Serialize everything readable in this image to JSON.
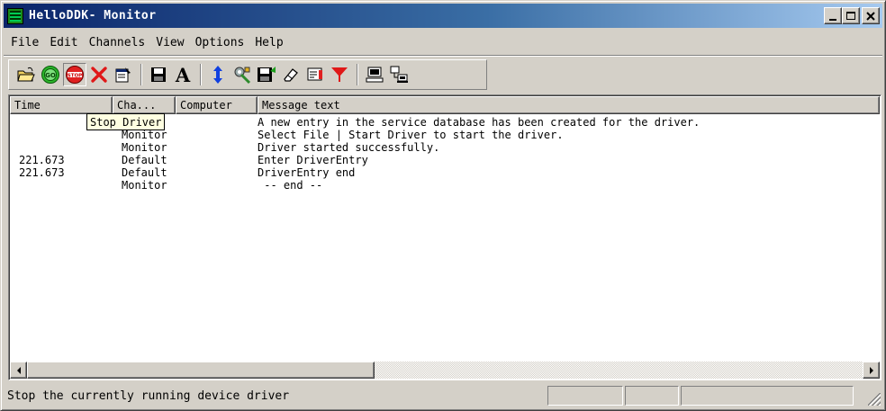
{
  "window": {
    "title": "HelloDDK- Monitor"
  },
  "menu": [
    "File",
    "Edit",
    "Channels",
    "View",
    "Options",
    "Help"
  ],
  "toolbar": {
    "icons": [
      "open-folder-icon",
      "go-start-icon",
      "stop-icon",
      "delete-icon",
      "properties-icon",
      "save-icon",
      "font-icon",
      "sort-icon",
      "settings-icon",
      "save-log-icon",
      "eraser-icon",
      "highlight-icon",
      "filter-icon",
      "computer-icon",
      "network-icon"
    ]
  },
  "columns": {
    "time": "Time",
    "channel": "Cha...",
    "computer": "Computer",
    "message": "Message text"
  },
  "rows": [
    {
      "time": "",
      "channel": "",
      "computer": "",
      "message": "A new entry in the service database has been created for the driver."
    },
    {
      "time": "",
      "channel": "Monitor",
      "computer": "",
      "message": "Select File | Start Driver to start the driver."
    },
    {
      "time": "",
      "channel": "Monitor",
      "computer": "",
      "message": "Driver started successfully."
    },
    {
      "time": "221.673",
      "channel": "Default",
      "computer": "",
      "message": "Enter DriverEntry"
    },
    {
      "time": "221.673",
      "channel": "Default",
      "computer": "",
      "message": "DriverEntry end"
    },
    {
      "time": "",
      "channel": "Monitor",
      "computer": "",
      "message": " -- end --"
    }
  ],
  "tooltip": "Stop Driver",
  "statusbar": {
    "text": "Stop the currently running device driver"
  },
  "colors": {
    "titlebar_start": "#0a246a",
    "titlebar_end": "#a6caf0",
    "tooltip_bg": "#ffffe1",
    "face": "#d4d0c8"
  }
}
